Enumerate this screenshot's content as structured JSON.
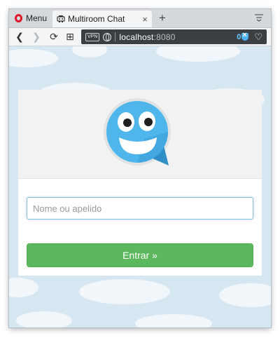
{
  "browser": {
    "menu_label": "Menu",
    "tab": {
      "title": "Multiroom Chat",
      "close": "×"
    },
    "new_tab": "+",
    "vpn_badge": "VPN",
    "address": {
      "host": "localhost",
      "port": ":8080"
    },
    "adblock_count": "0",
    "heart": "♡",
    "nav": {
      "back": "❮",
      "forward": "❯",
      "reload": "⟳",
      "grid": "⊞"
    }
  },
  "login": {
    "nickname_placeholder": "Nome ou apelido",
    "nickname_value": "",
    "submit_label": "Entrar »"
  },
  "colors": {
    "sky": "#d6e7f2",
    "cloud": "#f1f6fa",
    "logo_blue": "#4fb6ec",
    "submit_green": "#5cb85c",
    "address_bar": "#3b3f43"
  }
}
